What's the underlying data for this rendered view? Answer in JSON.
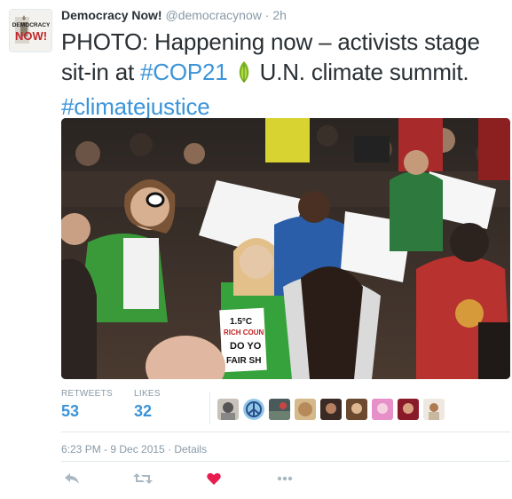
{
  "tweet": {
    "avatar_logo_text": [
      "DEMOCRACY",
      "NOW!"
    ],
    "display_name": "Democracy Now!",
    "handle": "@democracynow",
    "separator": "·",
    "time_ago": "2h",
    "text_part1": "PHOTO: Happening now – activists stage sit-in at ",
    "hashtag1": "#COP21",
    "text_part2": " U.N. climate summit.",
    "hashtag2": "#climatejustice",
    "photo_sign_text": [
      "1.5°C",
      "RICH COUN",
      "DO YO",
      "FAIR SH"
    ],
    "emoji_icon": "green-leaf-icon"
  },
  "stats": {
    "retweets_label": "RETWEETS",
    "retweets_value": "53",
    "likes_label": "LIKES",
    "likes_value": "32"
  },
  "footer": {
    "timestamp": "6:23 PM - 9 Dec 2015 · Details"
  },
  "colors": {
    "link": "#3b94d9",
    "text": "#292f33",
    "muted": "#8899a6",
    "like": "#e81c4f",
    "divider": "#e1e8ed"
  }
}
